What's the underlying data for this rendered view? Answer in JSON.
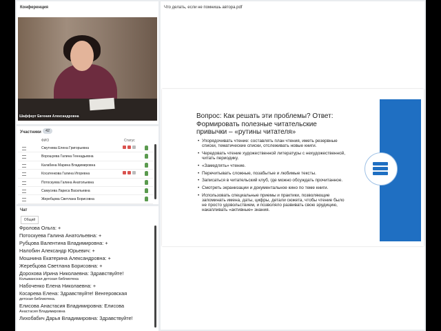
{
  "conference": {
    "title": "Конференция",
    "presenter_caption": "Шафферт Евгения Александровна"
  },
  "participants": {
    "title": "Участники",
    "count": "42",
    "col_name": "ФИО",
    "col_status": "Статус",
    "rows": [
      {
        "name": "Смутнева Елена Григорьевна",
        "icons": true
      },
      {
        "name": "Ворошуева Галина Геннадьевна",
        "icons": false
      },
      {
        "name": "Калабина Марина Владимировна",
        "icons": false
      },
      {
        "name": "Косатенкова Галина Игоревна",
        "icons": true
      },
      {
        "name": "Потоскуева Галина Анатольевна",
        "icons": false
      },
      {
        "name": "Самусева Лариса Васильевна",
        "icons": false
      },
      {
        "name": "Жеребцова Светлана Борисовна",
        "icons": false
      }
    ]
  },
  "chat": {
    "title": "Чат",
    "tab": "Общий",
    "messages": [
      {
        "text": "Фролова Ольга: +",
        "sub": ""
      },
      {
        "text": "Потоскуева Галина Анатольевна: +",
        "sub": ""
      },
      {
        "text": "Рубцова Валентина Владимировна: +",
        "sub": ""
      },
      {
        "text": "Налобин Александр Юрьевич: +",
        "sub": ""
      },
      {
        "text": "Мошнина Екатерина Александровна: +",
        "sub": ""
      },
      {
        "text": "Жеребцова Светлана Борисовна: +",
        "sub": ""
      },
      {
        "text": "Дорохова Ирина Николаевна: Здравствуйте!",
        "sub": "Колыванская детская библиотека"
      },
      {
        "text": "Набоченко Елена Николаевна: +",
        "sub": ""
      },
      {
        "text": "Косарева Елена: Здравствуйте! Венгеровская",
        "sub": "детская библиотека."
      },
      {
        "text": "Елисова Анастасия Владимировна: Елисова",
        "sub": "Анастасия Владимировна"
      },
      {
        "text": "Лихобабич Дарья Владимировна: Здравствуйте!",
        "sub": ""
      }
    ]
  },
  "pdf": {
    "title": "Что делать, если не помнишь автора.pdf",
    "question": "Вопрос: Как решать эти проблемы? Ответ: Формировать полезные читательские привычки – «рутины читателя»",
    "bullets": [
      "Упорядочивать чтение: составлять план чтения, иметь резервные списки, тематические списки, отслеживать новые книги.",
      "Чередовать чтение художественной литературы с нехудожественной, читать периодику.",
      "«Замедлять» чтение.",
      "Перечитывать сложные, позабытые и любимые тексты.",
      "Записаться в читательский клуб, где можно обсуждать прочитанное.",
      "Смотреть экранизации и документальное кино по теме книги.",
      "Использовать специальные приемы и практики, позволяющие запоминать имена, даты, цифры, детали сюжета, чтобы чтение было не просто удовольствием, и позволяло развивать свою эрудицию, накапливать «активные» знания."
    ],
    "accent": "#1f6fc2"
  }
}
